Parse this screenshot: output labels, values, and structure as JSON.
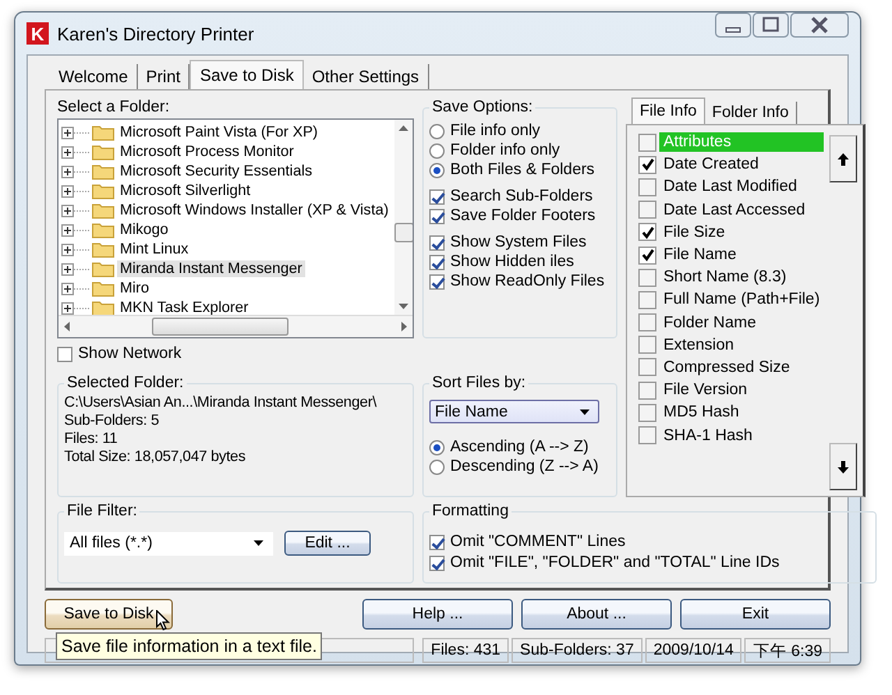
{
  "window": {
    "title": "Karen's Directory Printer",
    "icon_letter": "K"
  },
  "tabs": [
    {
      "label": "Welcome",
      "selected": false
    },
    {
      "label": "Print",
      "selected": false
    },
    {
      "label": "Save to Disk",
      "selected": true
    },
    {
      "label": "Other Settings",
      "selected": false
    }
  ],
  "folder_tree": {
    "label": "Select a Folder:",
    "items": [
      {
        "name": "Microsoft Paint Vista (For XP)",
        "selected": false
      },
      {
        "name": "Microsoft Process Monitor",
        "selected": false
      },
      {
        "name": "Microsoft Security Essentials",
        "selected": false
      },
      {
        "name": "Microsoft Silverlight",
        "selected": false
      },
      {
        "name": "Microsoft Windows Installer (XP & Vista)",
        "selected": false
      },
      {
        "name": "Mikogo",
        "selected": false
      },
      {
        "name": "Mint Linux",
        "selected": false
      },
      {
        "name": "Miranda Instant Messenger",
        "selected": true
      },
      {
        "name": "Miro",
        "selected": false
      },
      {
        "name": "MKN Task Explorer",
        "selected": false
      }
    ]
  },
  "show_network": {
    "label": "Show Network",
    "checked": false
  },
  "selected_folder": {
    "title": "Selected Folder:",
    "lines": [
      "C:\\Users\\Asian An...\\Miranda Instant Messenger\\",
      "Sub-Folders: 5",
      "Files: 11",
      "Total Size: 18,057,047 bytes"
    ]
  },
  "file_filter": {
    "title": "File Filter:",
    "value": "All files (*.*)",
    "button": "Edit ..."
  },
  "save_options": {
    "title": "Save Options:",
    "radios": [
      {
        "label": "File info only",
        "selected": false
      },
      {
        "label": "Folder info only",
        "selected": false
      },
      {
        "label": "Both Files & Folders",
        "selected": true
      }
    ],
    "check_groups": [
      [
        {
          "label": "Search Sub-Folders",
          "checked": true
        },
        {
          "label": "Save Folder Footers",
          "checked": true
        }
      ],
      [
        {
          "label": "Show System Files",
          "checked": true
        },
        {
          "label": "Show Hidden iles",
          "checked": true
        },
        {
          "label": "Show ReadOnly Files",
          "checked": true
        }
      ]
    ]
  },
  "sort": {
    "title": "Sort Files by:",
    "value": "File Name",
    "radios": [
      {
        "label": "Ascending (A --> Z)",
        "selected": true
      },
      {
        "label": "Descending (Z --> A)",
        "selected": false
      }
    ]
  },
  "formatting": {
    "title": "Formatting",
    "checks": [
      {
        "label": "Omit \"COMMENT\" Lines",
        "checked": true
      },
      {
        "label": "Omit \"FILE\", \"FOLDER\" and \"TOTAL\" Line IDs",
        "checked": true
      }
    ]
  },
  "info_tabs": [
    {
      "label": "File Info",
      "selected": true
    },
    {
      "label": "Folder Info",
      "selected": false
    }
  ],
  "fields": [
    {
      "label": "Attributes",
      "checked": false,
      "selected": true
    },
    {
      "label": "Date Created",
      "checked": true,
      "selected": false
    },
    {
      "label": "Date Last Modified",
      "checked": false,
      "selected": false
    },
    {
      "label": "Date Last Accessed",
      "checked": false,
      "selected": false
    },
    {
      "label": "File Size",
      "checked": true,
      "selected": false
    },
    {
      "label": "File Name",
      "checked": true,
      "selected": false
    },
    {
      "label": "Short Name (8.3)",
      "checked": false,
      "selected": false
    },
    {
      "label": "Full Name (Path+File)",
      "checked": false,
      "selected": false
    },
    {
      "label": "Folder Name",
      "checked": false,
      "selected": false
    },
    {
      "label": "Extension",
      "checked": false,
      "selected": false
    },
    {
      "label": "Compressed Size",
      "checked": false,
      "selected": false
    },
    {
      "label": "File Version",
      "checked": false,
      "selected": false
    },
    {
      "label": "MD5 Hash",
      "checked": false,
      "selected": false
    },
    {
      "label": "SHA-1 Hash",
      "checked": false,
      "selected": false
    }
  ],
  "buttons": [
    {
      "label": "Save to Disk",
      "hovered": true
    },
    {
      "label": "Help ...",
      "hovered": false
    },
    {
      "label": "About ...",
      "hovered": false
    },
    {
      "label": "Exit",
      "hovered": false
    }
  ],
  "tooltip": "Save file information in a text file.",
  "status_bar": [
    "Files: 431",
    "Sub-Folders: 37",
    "2009/10/14",
    "下午 6:39"
  ]
}
